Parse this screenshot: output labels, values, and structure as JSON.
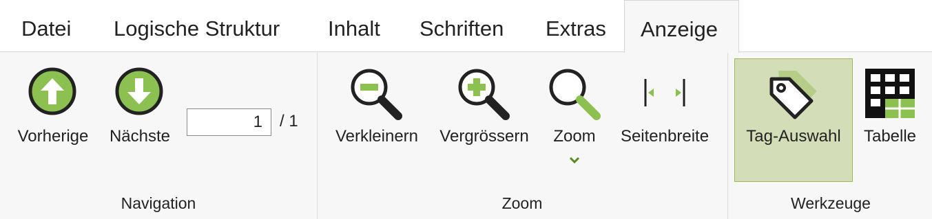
{
  "tabs": [
    {
      "label": "Datei",
      "active": false
    },
    {
      "label": "Logische Struktur",
      "active": false
    },
    {
      "label": "Inhalt",
      "active": false
    },
    {
      "label": "Schriften",
      "active": false
    },
    {
      "label": "Extras",
      "active": false
    },
    {
      "label": "Anzeige",
      "active": true
    }
  ],
  "groups": {
    "navigation": {
      "label": "Navigation",
      "previous": "Vorherige",
      "next": "Nächste",
      "page_value": "1",
      "page_total": "/ 1"
    },
    "zoom": {
      "label": "Zoom",
      "zoom_out": "Verkleinern",
      "zoom_in": "Vergrössern",
      "zoom": "Zoom",
      "page_width": "Seitenbreite"
    },
    "tools": {
      "label": "Werkzeuge",
      "tag_select": "Tag-Auswahl",
      "table": "Tabelle"
    }
  },
  "colors": {
    "accent_green": "#8cc152",
    "dark_icon": "#222222",
    "selected_bg": "#d3deb8",
    "selected_border": "#9dbb5e"
  },
  "icons": {
    "previous": "arrow-up-circle-icon",
    "next": "arrow-down-circle-icon",
    "zoom_out": "zoom-out-icon",
    "zoom_in": "zoom-in-icon",
    "zoom": "magnifier-icon",
    "zoom_dropdown": "chevron-down-icon",
    "page_width": "fit-width-icon",
    "tag_select": "tag-icon",
    "table": "table-grid-icon"
  }
}
